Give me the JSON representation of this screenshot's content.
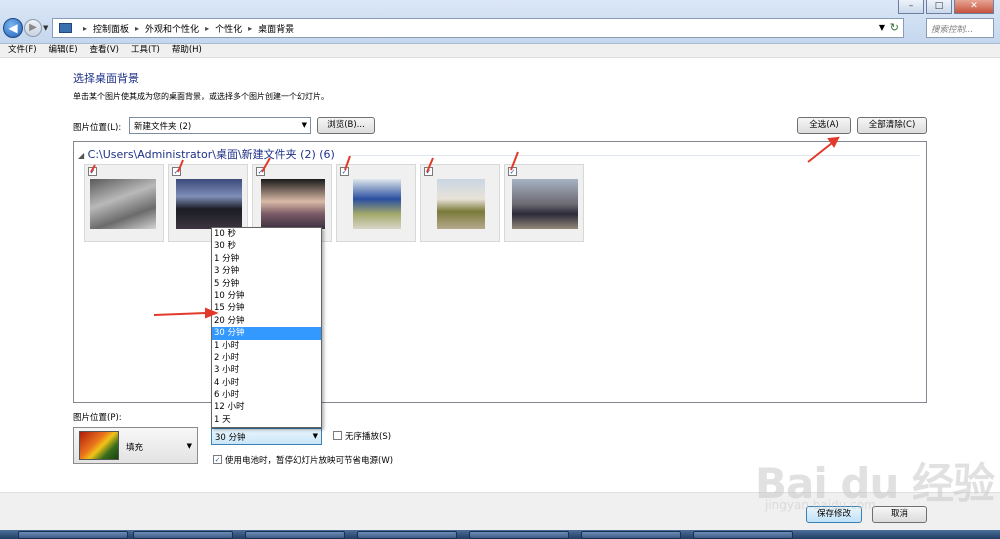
{
  "address_bar": {
    "crumbs": [
      "控制面板",
      "外观和个性化",
      "个性化",
      "桌面背景"
    ],
    "search_placeholder": "搜索控制..."
  },
  "menu": [
    "文件(F)",
    "编辑(E)",
    "查看(V)",
    "工具(T)",
    "帮助(H)"
  ],
  "page": {
    "heading": "选择桌面背景",
    "subtext": "单击某个图片使其成为您的桌面背景，或选择多个图片创建一个幻灯片。"
  },
  "location": {
    "label": "图片位置(L):",
    "value": "新建文件夹 (2)",
    "browse": "浏览(B)..."
  },
  "select_all": "全选(A)",
  "clear_all": "全部清除(C)",
  "gallery": {
    "group_header": "C:\\Users\\Administrator\\桌面\\新建文件夹 (2) (6)",
    "thumbnails": [
      {
        "checked": "✓"
      },
      {
        "checked": "✓"
      },
      {
        "checked": "✓"
      },
      {
        "checked": "✓"
      },
      {
        "checked": "✓"
      },
      {
        "checked": "✓"
      }
    ]
  },
  "interval_options": [
    "10 秒",
    "30 秒",
    "1 分钟",
    "3 分钟",
    "5 分钟",
    "10 分钟",
    "15 分钟",
    "20 分钟",
    "30 分钟",
    "1 小时",
    "2 小时",
    "3 小时",
    "4 小时",
    "6 小时",
    "12 小时",
    "1 天"
  ],
  "interval_selected_index": 8,
  "picture_position": {
    "label": "图片位置(P):",
    "value": "填充"
  },
  "interval_value": "30 分钟",
  "shuffle_label": "无序播放(S)",
  "battery_label": "使用电池时，暂停幻灯片放映可节省电源(W)",
  "battery_checked": "✓",
  "save_button": "保存修改",
  "cancel_button": "取消",
  "watermark": {
    "text": "Bai du 经验",
    "sub": "jingyan.baidu.com"
  },
  "colors": {
    "heading": "#1e3287",
    "selection": "#3399ff",
    "annotation_arrow": "#e23a2a"
  }
}
